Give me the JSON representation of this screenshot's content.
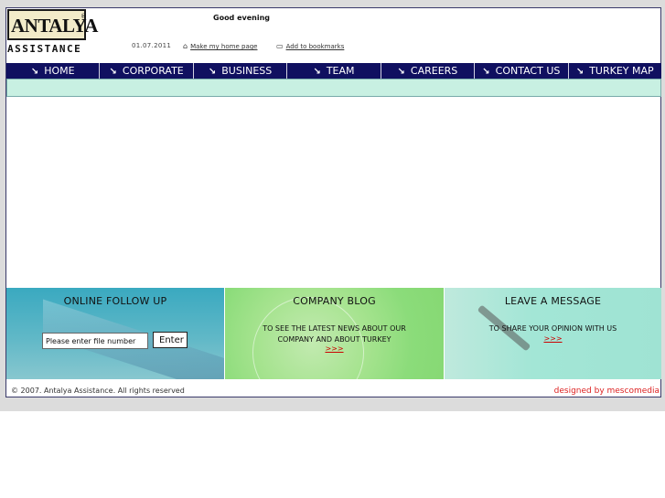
{
  "header": {
    "logo_text": "ANTALYA",
    "logo_sub": "ASSISTANCE",
    "logo_reg": "®",
    "greeting": "Good evening",
    "date": "01.07.2011",
    "home_link": "Make my home page",
    "bookmark_link": "Add to bookmarks",
    "home_icon": "home-icon",
    "bookmark_icon": "folder-icon"
  },
  "nav": {
    "arrow": "↘",
    "items": [
      {
        "label": "HOME"
      },
      {
        "label": "CORPORATE"
      },
      {
        "label": "BUSINESS"
      },
      {
        "label": "TEAM"
      },
      {
        "label": "CAREERS"
      },
      {
        "label": "CONTACT US"
      },
      {
        "label": "TURKEY MAP"
      }
    ]
  },
  "panels": {
    "follow": {
      "title": "ONLINE FOLLOW UP",
      "input_value": "Please enter file number",
      "button": "Enter"
    },
    "blog": {
      "title": "COMPANY BLOG",
      "text_line1": "TO SEE THE LATEST NEWS ABOUT OUR",
      "text_line2": "COMPANY AND ABOUT TURKEY",
      "more": ">>>"
    },
    "message": {
      "title": "LEAVE A MESSAGE",
      "text": "TO SHARE YOUR OPINION WITH US",
      "more": ">>>"
    }
  },
  "footer": {
    "copyright": "© 2007. Antalya Assistance. All rights reserved",
    "designer": "designed by mescomedia"
  },
  "colors": {
    "nav_bg": "#101060",
    "subbar": "#c8f0e2",
    "accent_red": "#d22222"
  }
}
